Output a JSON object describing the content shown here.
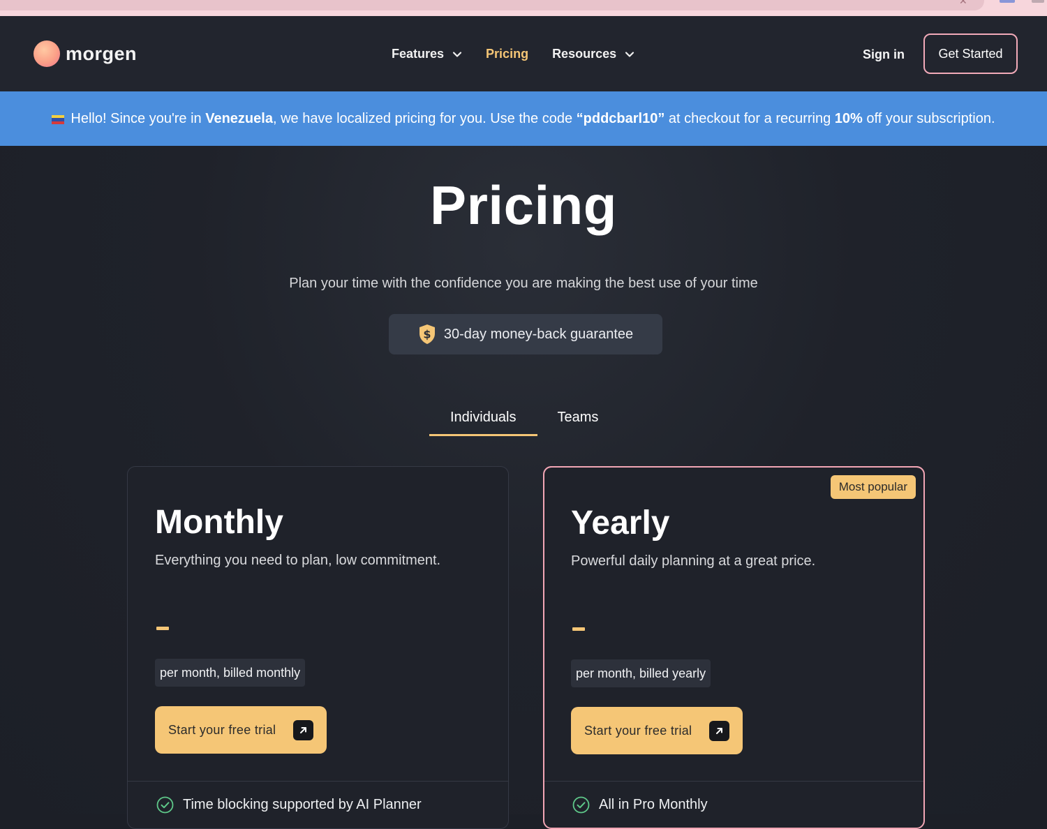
{
  "nav": {
    "logo_text": "morgen",
    "links": [
      {
        "label": "Features",
        "has_dropdown": true
      },
      {
        "label": "Pricing",
        "active": true
      },
      {
        "label": "Resources",
        "has_dropdown": true
      }
    ],
    "sign_in": "Sign in",
    "get_started": "Get Started"
  },
  "banner": {
    "flag_icon": "venezuela-flag-icon",
    "prefix": "Hello! Since you're in ",
    "country": "Venezuela",
    "middle": ", we have localized pricing for you. Use the code ",
    "code": "“pddcbarl10”",
    "after_code": " at checkout for a recurring ",
    "discount": "10%",
    "suffix": " off your subscription."
  },
  "hero": {
    "title": "Pricing",
    "subtitle": "Plan your time with the confidence you are making the best use of your time",
    "guarantee": "30-day money-back guarantee",
    "guarantee_icon": "shield-dollar-icon"
  },
  "tabs": [
    {
      "label": "Individuals",
      "active": true
    },
    {
      "label": "Teams",
      "active": false
    }
  ],
  "plans": [
    {
      "name": "Monthly",
      "description": "Everything you need to plan, low commitment.",
      "billing": "per month, billed monthly",
      "cta": "Start your free trial",
      "feature": "Time blocking supported by AI Planner"
    },
    {
      "name": "Yearly",
      "badge": "Most popular",
      "description": "Powerful daily planning at a great price.",
      "billing": "per month, billed yearly",
      "cta": "Start your free trial",
      "feature": "All in Pro Monthly"
    }
  ],
  "colors": {
    "accent": "#f5c676",
    "banner": "#4b8edd",
    "highlight_border": "#f2a6b5",
    "background": "#1c1f27"
  }
}
